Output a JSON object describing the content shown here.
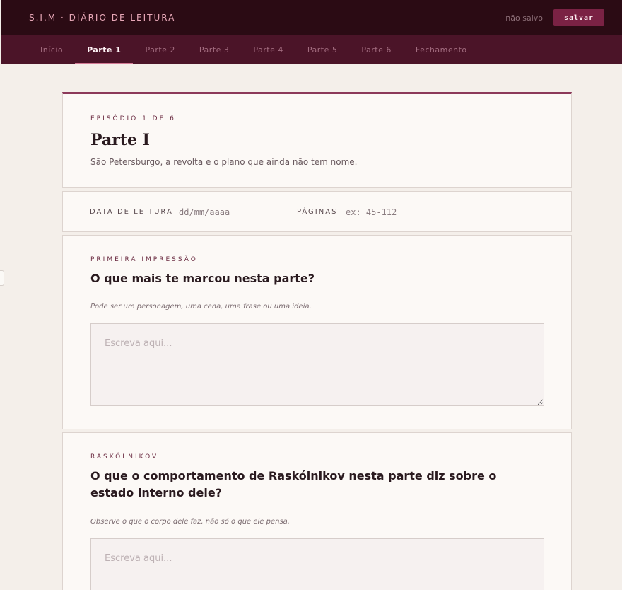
{
  "header": {
    "brand": "S.I.M · DIÁRIO DE LEITURA",
    "save_status": "não salvo",
    "save_label": "salvar"
  },
  "tabs": [
    {
      "label": "Início",
      "active": false
    },
    {
      "label": "Parte 1",
      "active": true
    },
    {
      "label": "Parte 2",
      "active": false
    },
    {
      "label": "Parte 3",
      "active": false
    },
    {
      "label": "Parte 4",
      "active": false
    },
    {
      "label": "Parte 5",
      "active": false
    },
    {
      "label": "Parte 6",
      "active": false
    },
    {
      "label": "Fechamento",
      "active": false
    }
  ],
  "episode": {
    "eyebrow": "EPISÓDIO 1 DE 6",
    "title": "Parte I",
    "subtitle": "São Petersburgo, a revolta e o plano que ainda não tem nome."
  },
  "meta": {
    "date_label": "DATA DE LEITURA",
    "date_placeholder": "dd/mm/aaaa",
    "pages_label": "PÁGINAS",
    "pages_placeholder": "ex: 45-112"
  },
  "questions": [
    {
      "eyebrow": "PRIMEIRA IMPRESSÃO",
      "title": "O que mais te marcou nesta parte?",
      "hint": "Pode ser um personagem, uma cena, uma frase ou uma ideia.",
      "placeholder": "Escreva aqui..."
    },
    {
      "eyebrow": "RASKÓLNIKOV",
      "title": "O que o comportamento de Raskólnikov nesta parte diz sobre o estado interno dele?",
      "hint": "Observe o que o corpo dele faz, não só o que ele pensa.",
      "placeholder": "Escreva aqui..."
    }
  ],
  "colors": {
    "topbar": "#2b0b14",
    "tabbar": "#4b1428",
    "accent": "#7a2244",
    "brand_text": "#e7a7b7",
    "page_bg": "#f4efea"
  }
}
